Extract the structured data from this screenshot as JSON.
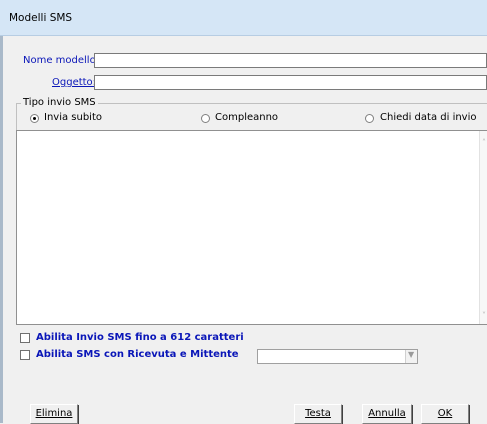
{
  "window": {
    "title": "Modelli SMS"
  },
  "form": {
    "nome_modello_label": "Nome modello:",
    "nome_modello_value": "",
    "oggetto_label": "Oggetto:",
    "oggetto_value": ""
  },
  "tipo_invio": {
    "group_label": "Tipo invio SMS",
    "options": [
      {
        "label": "Invia subito",
        "checked": true
      },
      {
        "label": "Compleanno",
        "checked": false
      },
      {
        "label": "Chiedi data di invio",
        "checked": false
      }
    ]
  },
  "message": {
    "text": ""
  },
  "options": {
    "enable_612_label": "Abilita Invio SMS fino a 612 caratteri",
    "enable_612_checked": false,
    "enable_receipt_label": "Abilita SMS con Ricevuta e Mittente",
    "enable_receipt_checked": false,
    "sender_selected": ""
  },
  "buttons": {
    "elimina": "Elimina",
    "testa": "Testa",
    "annulla": "Annulla",
    "ok": "OK"
  },
  "icons": {
    "scroll_up": "scroll-up-arrow-icon",
    "scroll_down": "scroll-down-arrow-icon",
    "dropdown": "chevron-down-icon"
  }
}
